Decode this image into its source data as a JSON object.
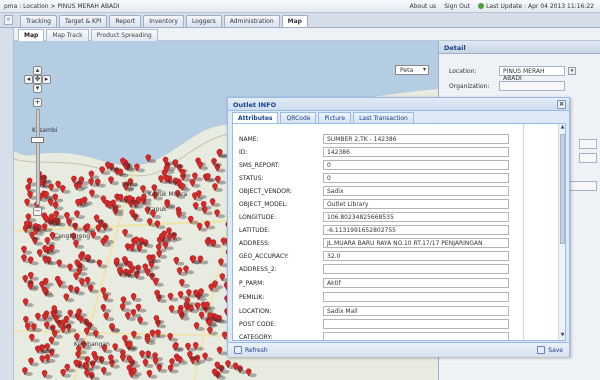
{
  "header": {
    "path": "pma : Location > PINUS MERAH ABADI",
    "about": "About us",
    "signout": "Sign Out",
    "last_update": "Last Update : Apr 04 2013 11:16:22"
  },
  "nav": {
    "collapse": "«",
    "tabs": [
      "Tracking",
      "Target & KPI",
      "Report",
      "Inventory",
      "Loggers",
      "Administration",
      "Map"
    ]
  },
  "subtabs": [
    "Map",
    "Map Track",
    "Product Spreading"
  ],
  "map": {
    "type_selector": "Peta",
    "labels": [
      "Kepu",
      "Kapuk Muara",
      "Kapuk",
      "Cengkareng",
      "Kosambi",
      "Kembangan"
    ]
  },
  "detail": {
    "title": "Detail",
    "location_label": "Location:",
    "location_value": "PINUS MERAH ABADI",
    "organization_label": "Organization:"
  },
  "dialog": {
    "title": "Outlet INFO",
    "tabs": [
      "Attributes",
      "QRCode",
      "Picture",
      "Last Transaction"
    ],
    "fields": [
      {
        "label": "NAME:",
        "value": "SUMBER 2,TK - 142386"
      },
      {
        "label": "ID:",
        "value": "142386"
      },
      {
        "label": "SMS_REPORT:",
        "value": "0"
      },
      {
        "label": "STATUS:",
        "value": "0"
      },
      {
        "label": "OBJECT_VENDOR:",
        "value": "Sadix"
      },
      {
        "label": "OBJECT_MODEL:",
        "value": "Outlet Library"
      },
      {
        "label": "LONGITUDE:",
        "value": "106.80234825668535"
      },
      {
        "label": "LATITUDE:",
        "value": "-6.1131991652802755"
      },
      {
        "label": "ADDRESS:",
        "value": "JL.MUARA BARU RAYA NO.10  RT.17/17 PENJARINGAN"
      },
      {
        "label": "GEO_ACCURACY:",
        "value": "32.0"
      },
      {
        "label": "ADDRESS_2:",
        "value": ""
      },
      {
        "label": "P_PARM:",
        "value": "Aktif"
      },
      {
        "label": "PEMILIK:",
        "value": ""
      },
      {
        "label": "LOCATION:",
        "value": "Sadix Mall"
      },
      {
        "label": "POST CODE:",
        "value": ""
      },
      {
        "label": "CATEGORY:",
        "value": ""
      }
    ],
    "refresh": "Refresh",
    "save": "Save"
  },
  "colors": {
    "marker": "#d42a2a",
    "accent": "#15428b",
    "sea": "#b5cde3"
  }
}
